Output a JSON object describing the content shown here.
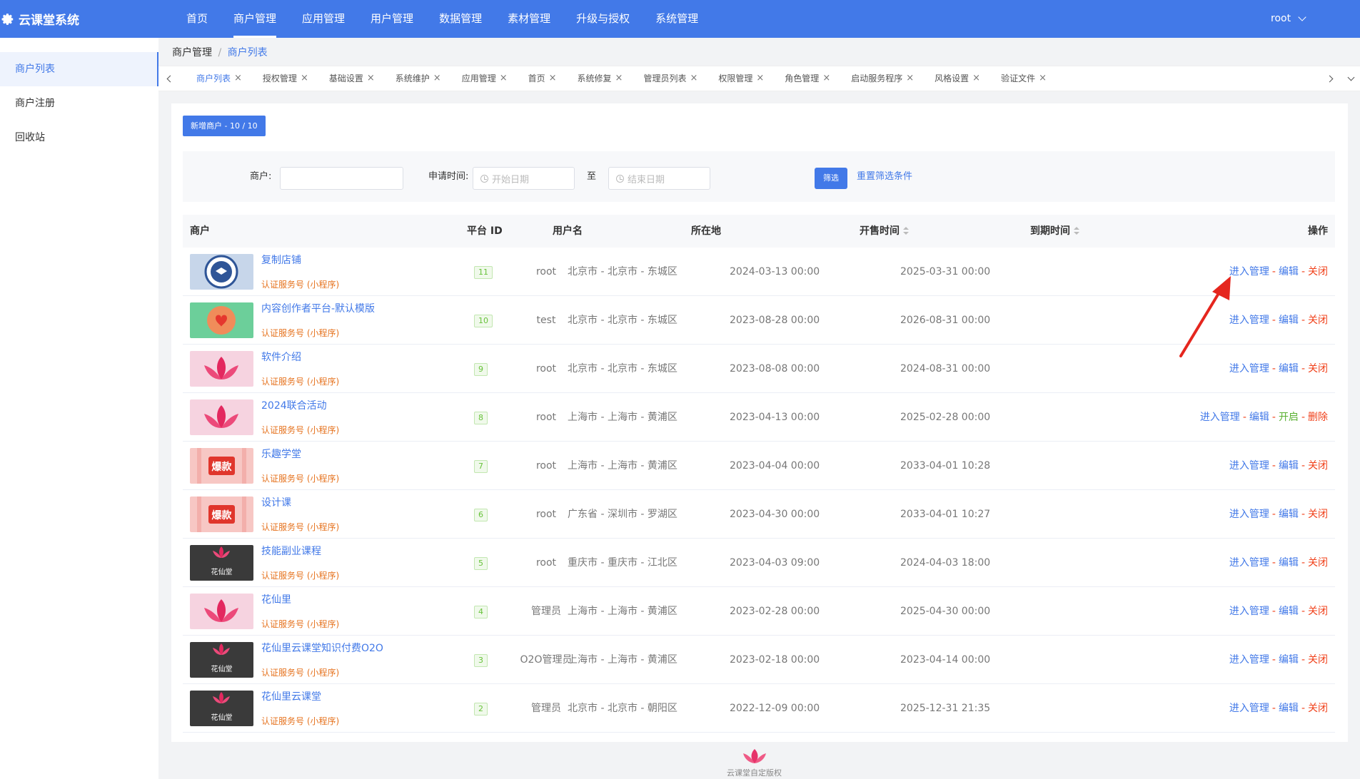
{
  "app": {
    "title": "云课堂系统"
  },
  "topnav": [
    {
      "label": "首页"
    },
    {
      "label": "商户管理",
      "active": true
    },
    {
      "label": "应用管理"
    },
    {
      "label": "用户管理"
    },
    {
      "label": "数据管理"
    },
    {
      "label": "素材管理"
    },
    {
      "label": "升级与授权"
    },
    {
      "label": "系统管理"
    }
  ],
  "user": {
    "name": "root"
  },
  "sidebar": [
    {
      "label": "商户列表",
      "active": true
    },
    {
      "label": "商户注册"
    },
    {
      "label": "回收站"
    }
  ],
  "breadcrumb": {
    "parent": "商户管理",
    "separator": "/",
    "current": "商户列表"
  },
  "tabs": [
    {
      "label": "商户列表",
      "active": true
    },
    {
      "label": "授权管理"
    },
    {
      "label": "基础设置"
    },
    {
      "label": "系统维护"
    },
    {
      "label": "应用管理"
    },
    {
      "label": "首页"
    },
    {
      "label": "系统修复"
    },
    {
      "label": "管理员列表"
    },
    {
      "label": "权限管理"
    },
    {
      "label": "角色管理"
    },
    {
      "label": "启动服务程序"
    },
    {
      "label": "风格设置"
    },
    {
      "label": "验证文件"
    }
  ],
  "toolbar": {
    "add_label": "新增商户 - 10 / 10"
  },
  "filter": {
    "merchant_label": "商户:",
    "merchant_value": "",
    "time_label": "申请时间:",
    "start_placeholder": "开始日期",
    "to_label": "至",
    "end_placeholder": "结束日期",
    "submit_label": "筛选",
    "reset_label": "重置筛选条件"
  },
  "table": {
    "headers": {
      "merchant": "商户",
      "platform_id": "平台 ID",
      "username": "用户名",
      "location": "所在地",
      "start": "开售时间",
      "end": "到期时间",
      "actions": "操作"
    },
    "rows": [
      {
        "name": "复制店铺",
        "type": "认证服务号 (小程序)",
        "thumb": "seal",
        "id": "11",
        "user": "root",
        "loc": "北京市 - 北京市 - 东城区",
        "start": "2024-03-13 00:00",
        "end": "2025-03-31 00:00",
        "ops": [
          {
            "label": "进入管理",
            "color": "blue"
          },
          {
            "label": "编辑",
            "color": "blue"
          },
          {
            "label": "关闭",
            "color": "red"
          }
        ]
      },
      {
        "name": "内容创作者平台-默认模版",
        "type": "认证服务号 (小程序)",
        "thumb": "green",
        "id": "10",
        "user": "test",
        "loc": "北京市 - 北京市 - 东城区",
        "start": "2023-08-28 00:00",
        "end": "2026-08-31 00:00",
        "ops": [
          {
            "label": "进入管理",
            "color": "blue"
          },
          {
            "label": "编辑",
            "color": "blue"
          },
          {
            "label": "关闭",
            "color": "red"
          }
        ]
      },
      {
        "name": "软件介绍",
        "type": "认证服务号 (小程序)",
        "thumb": "lotus",
        "id": "9",
        "user": "root",
        "loc": "北京市 - 北京市 - 东城区",
        "start": "2023-08-08 00:00",
        "end": "2024-08-31 00:00",
        "ops": [
          {
            "label": "进入管理",
            "color": "blue"
          },
          {
            "label": "编辑",
            "color": "blue"
          },
          {
            "label": "关闭",
            "color": "red"
          }
        ]
      },
      {
        "name": "2024联合活动",
        "type": "认证服务号 (小程序)",
        "thumb": "lotus",
        "id": "8",
        "user": "root",
        "loc": "上海市 - 上海市 - 黄浦区",
        "start": "2023-04-13 00:00",
        "end": "2025-02-28 00:00",
        "ops": [
          {
            "label": "进入管理",
            "color": "blue"
          },
          {
            "label": "编辑",
            "color": "blue"
          },
          {
            "label": "开启",
            "color": "green"
          },
          {
            "label": "删除",
            "color": "red"
          }
        ]
      },
      {
        "name": "乐趣学堂",
        "type": "认证服务号 (小程序)",
        "thumb": "baokuan",
        "thumb_text": "爆款",
        "id": "7",
        "user": "root",
        "loc": "上海市 - 上海市 - 黄浦区",
        "start": "2023-04-04 00:00",
        "end": "2033-04-01 10:28",
        "ops": [
          {
            "label": "进入管理",
            "color": "blue"
          },
          {
            "label": "编辑",
            "color": "blue"
          },
          {
            "label": "关闭",
            "color": "red"
          }
        ]
      },
      {
        "name": "设计课",
        "type": "认证服务号 (小程序)",
        "thumb": "baokuan",
        "thumb_text": "爆款",
        "id": "6",
        "user": "root",
        "loc": "广东省 - 深圳市 - 罗湖区",
        "start": "2023-04-30 00:00",
        "end": "2033-04-01 10:27",
        "ops": [
          {
            "label": "进入管理",
            "color": "blue"
          },
          {
            "label": "编辑",
            "color": "blue"
          },
          {
            "label": "关闭",
            "color": "red"
          }
        ]
      },
      {
        "name": "技能副业课程",
        "type": "认证服务号 (小程序)",
        "thumb": "dark",
        "thumb_text": "花仙堂",
        "id": "5",
        "user": "root",
        "loc": "重庆市 - 重庆市 - 江北区",
        "start": "2023-04-03 09:00",
        "end": "2024-04-03 18:00",
        "ops": [
          {
            "label": "进入管理",
            "color": "blue"
          },
          {
            "label": "编辑",
            "color": "blue"
          },
          {
            "label": "关闭",
            "color": "red"
          }
        ]
      },
      {
        "name": "花仙里",
        "type": "认证服务号 (小程序)",
        "thumb": "lotus",
        "id": "4",
        "user": "管理员",
        "loc": "上海市 - 上海市 - 黄浦区",
        "start": "2023-02-28 00:00",
        "end": "2025-04-30 00:00",
        "ops": [
          {
            "label": "进入管理",
            "color": "blue"
          },
          {
            "label": "编辑",
            "color": "blue"
          },
          {
            "label": "关闭",
            "color": "red"
          }
        ]
      },
      {
        "name": "花仙里云课堂知识付费O2O",
        "type": "认证服务号 (小程序)",
        "thumb": "dark",
        "thumb_text": "花仙堂",
        "id": "3",
        "user": "O2O管理员",
        "loc": "上海市 - 上海市 - 黄浦区",
        "start": "2023-02-18 00:00",
        "end": "2023-04-14 00:00",
        "ops": [
          {
            "label": "进入管理",
            "color": "blue"
          },
          {
            "label": "编辑",
            "color": "blue"
          },
          {
            "label": "关闭",
            "color": "red"
          }
        ]
      },
      {
        "name": "花仙里云课堂",
        "type": "认证服务号 (小程序)",
        "thumb": "dark",
        "thumb_text": "花仙堂",
        "id": "2",
        "user": "管理员",
        "loc": "北京市 - 北京市 - 朝阳区",
        "start": "2022-12-09 00:00",
        "end": "2025-12-31 21:35",
        "ops": [
          {
            "label": "进入管理",
            "color": "blue"
          },
          {
            "label": "编辑",
            "color": "blue"
          },
          {
            "label": "关闭",
            "color": "red"
          }
        ]
      }
    ]
  },
  "footer": {
    "text": "云课堂自定版权"
  },
  "colors": {
    "primary": "#4279e8",
    "danger": "#f0401a",
    "success": "#5ab033",
    "warning": "#e6731f"
  }
}
